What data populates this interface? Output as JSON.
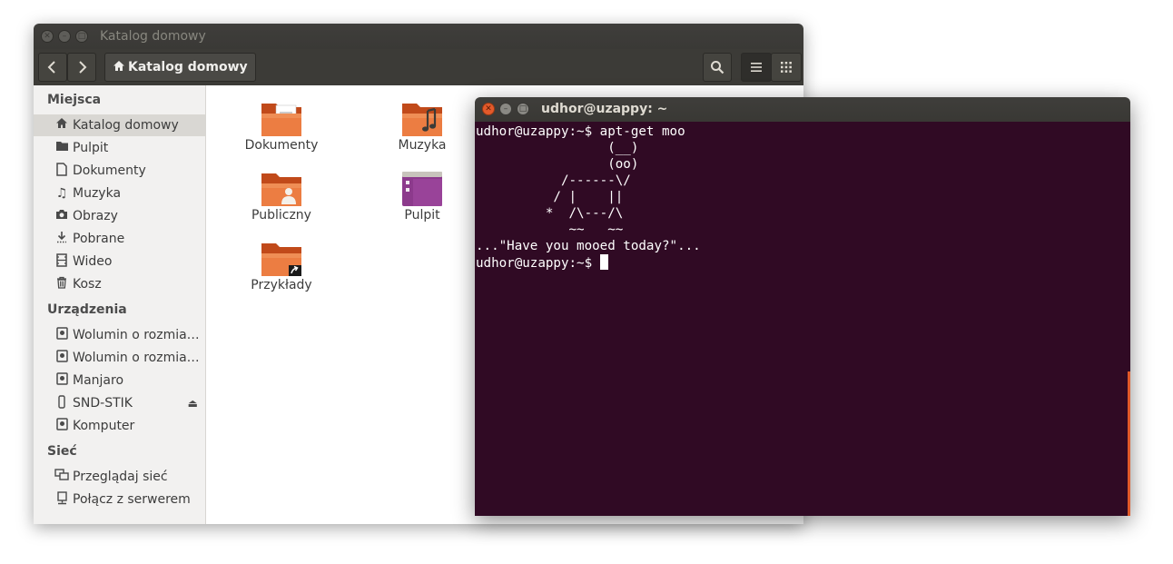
{
  "file_manager": {
    "title": "Katalog domowy",
    "breadcrumb": "Katalog domowy",
    "sidebar": {
      "sections": [
        {
          "heading": "Miejsca",
          "items": [
            {
              "label": "Katalog domowy",
              "icon": "home-icon",
              "active": true
            },
            {
              "label": "Pulpit",
              "icon": "folder-icon"
            },
            {
              "label": "Dokumenty",
              "icon": "document-icon"
            },
            {
              "label": "Muzyka",
              "icon": "music-icon"
            },
            {
              "label": "Obrazy",
              "icon": "camera-icon"
            },
            {
              "label": "Pobrane",
              "icon": "download-icon"
            },
            {
              "label": "Wideo",
              "icon": "film-icon"
            },
            {
              "label": "Kosz",
              "icon": "trash-icon"
            }
          ]
        },
        {
          "heading": "Urządzenia",
          "items": [
            {
              "label": "Wolumin o rozmia…",
              "icon": "drive-icon"
            },
            {
              "label": "Wolumin o rozmia…",
              "icon": "drive-icon"
            },
            {
              "label": "Manjaro",
              "icon": "drive-icon"
            },
            {
              "label": "SND-STIK",
              "icon": "usb-icon"
            },
            {
              "label": "Komputer",
              "icon": "drive-icon"
            }
          ]
        },
        {
          "heading": "Sieć",
          "items": [
            {
              "label": "Przeglądaj sieć",
              "icon": "network-icon"
            },
            {
              "label": "Połącz z serwerem",
              "icon": "server-icon"
            }
          ]
        }
      ]
    },
    "files": [
      {
        "label": "Dokumenty",
        "icon": "documents-folder-icon"
      },
      {
        "label": "Muzyka",
        "icon": "music-folder-icon"
      },
      {
        "label": "Publiczny",
        "icon": "public-folder-icon"
      },
      {
        "label": "Pulpit",
        "icon": "desktop-folder-icon"
      },
      {
        "label": "Przykłady",
        "icon": "examples-folder-icon"
      }
    ]
  },
  "terminal": {
    "title": "udhor@uzappy: ~",
    "lines": [
      "udhor@uzappy:~$ apt-get moo",
      "                 (__)",
      "                 (oo)",
      "           /------\\/",
      "          / |    ||",
      "         *  /\\---/\\",
      "            ~~   ~~",
      "...\"Have you mooed today?\"...",
      "udhor@uzappy:~$ "
    ]
  },
  "colors": {
    "terminal_bg": "#300a24",
    "titlebar_bg": "#3c3b37",
    "accent": "#e05a2a"
  }
}
